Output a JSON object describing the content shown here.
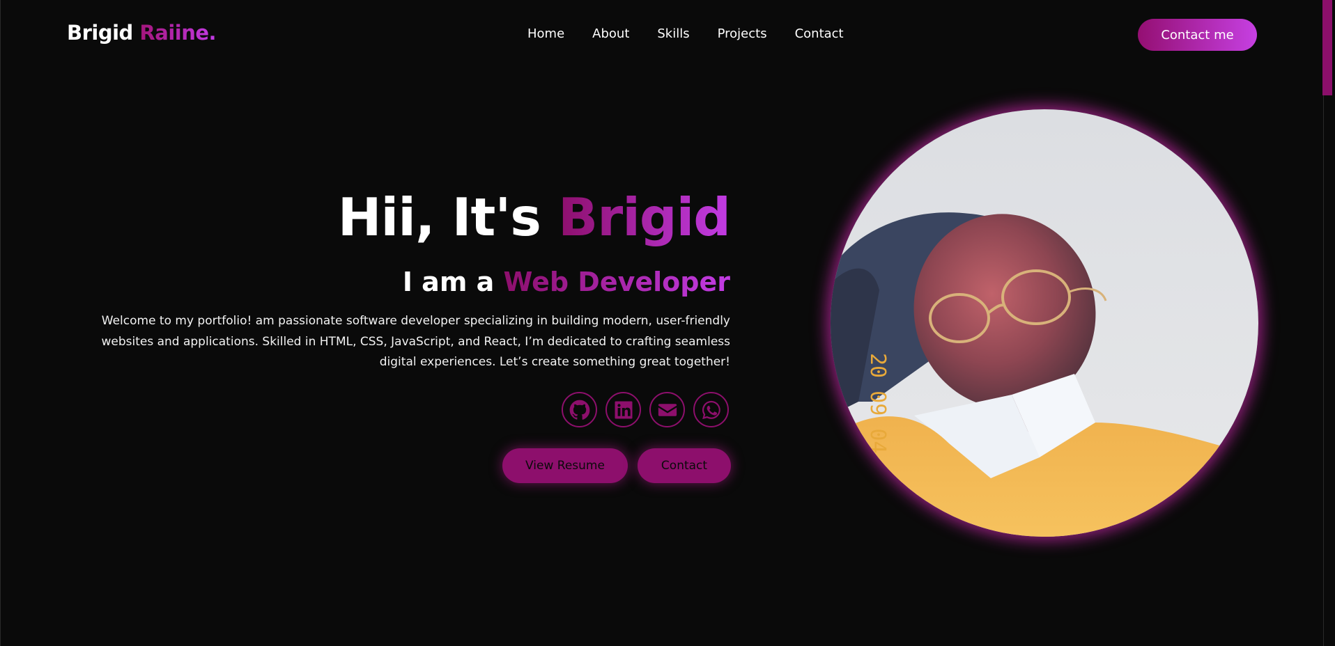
{
  "header": {
    "logo_first": "Brigid",
    "logo_second": "Raiine.",
    "nav": [
      "Home",
      "About",
      "Skills",
      "Projects",
      "Contact"
    ],
    "cta_label": "Contact me"
  },
  "hero": {
    "title_prefix": "Hii, It's ",
    "title_name": "Brigid",
    "subtitle_prefix": "I am a ",
    "subtitle_role": "Web Developer",
    "description": "Welcome to my portfolio! am passionate software developer specializing in building modern, user-friendly websites and applications. Skilled in HTML, CSS, JavaScript, and React, I’m dedicated to crafting seamless digital experiences. Let’s create something great together!",
    "socials": [
      "github-icon",
      "linkedin-icon",
      "email-icon",
      "whatsapp-icon"
    ],
    "buttons": {
      "resume": "View Resume",
      "contact": "Contact"
    },
    "photo_timestamp": "20 09 04"
  },
  "colors": {
    "background": "#0a0a0a",
    "accent_start": "#8d0f6c",
    "accent_end": "#c640e2"
  }
}
